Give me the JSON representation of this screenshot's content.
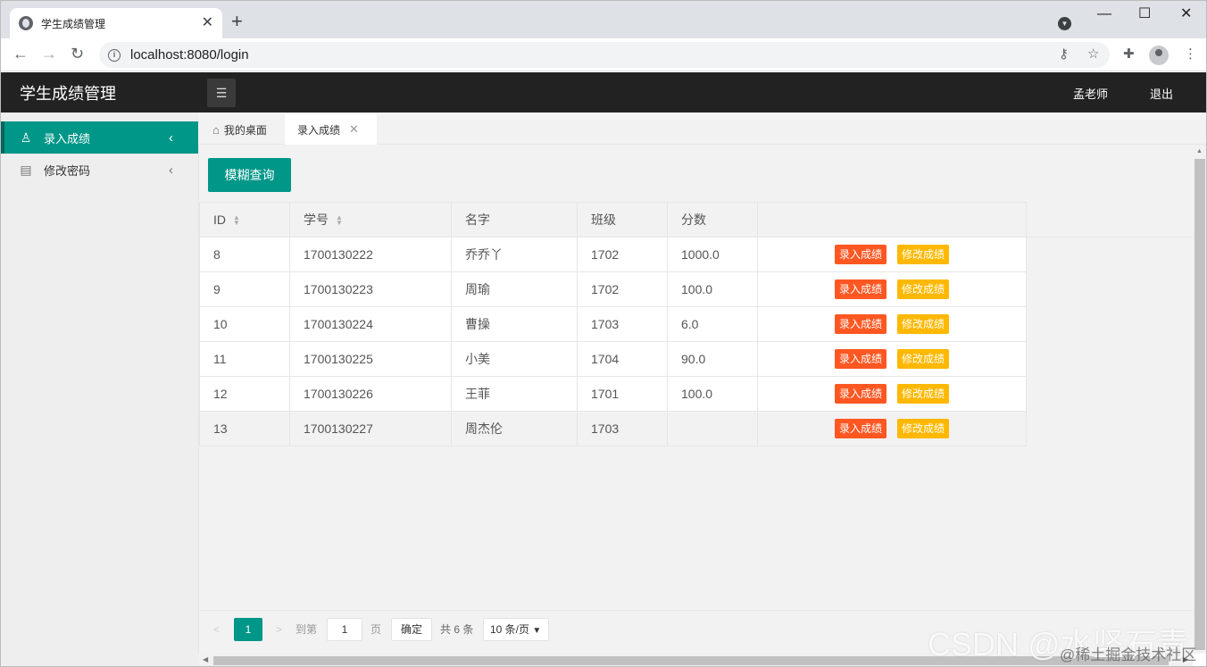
{
  "browser": {
    "tab_title": "学生成绩管理",
    "tab_close": "✕",
    "new_tab": "+",
    "url": "localhost:8080/login",
    "window_minimize": "—",
    "window_maximize": "☐",
    "window_close": "✕"
  },
  "app": {
    "title": "学生成绩管理",
    "user": "孟老师",
    "logout": "退出"
  },
  "sidebar": {
    "items": [
      {
        "label": "录入成绩",
        "icon": "user-icon",
        "active": true
      },
      {
        "label": "修改密码",
        "icon": "document-icon",
        "active": false
      }
    ]
  },
  "content_tabs": {
    "home": "我的桌面",
    "current": "录入成绩",
    "close": "✕"
  },
  "toolbar": {
    "search_label": "模糊查询"
  },
  "table": {
    "headers": [
      "ID",
      "学号",
      "名字",
      "班级",
      "分数",
      ""
    ],
    "rows": [
      {
        "id": "8",
        "student_no": "1700130222",
        "name": "乔乔丫",
        "class": "1702",
        "score": "1000.0"
      },
      {
        "id": "9",
        "student_no": "1700130223",
        "name": "周瑜",
        "class": "1702",
        "score": "100.0"
      },
      {
        "id": "10",
        "student_no": "1700130224",
        "name": "曹操",
        "class": "1703",
        "score": "6.0"
      },
      {
        "id": "11",
        "student_no": "1700130225",
        "name": "小美",
        "class": "1704",
        "score": "90.0"
      },
      {
        "id": "12",
        "student_no": "1700130226",
        "name": "王菲",
        "class": "1701",
        "score": "100.0"
      },
      {
        "id": "13",
        "student_no": "1700130227",
        "name": "周杰伦",
        "class": "1703",
        "score": ""
      }
    ],
    "action_enter": "录入成绩",
    "action_modify": "修改成绩"
  },
  "pager": {
    "prev": "<",
    "current_page": "1",
    "next": ">",
    "goto_label": "到第",
    "goto_value": "1",
    "page_unit": "页",
    "confirm": "确定",
    "total": "共 6 条",
    "page_size": "10 条/页"
  },
  "watermark": {
    "main": "CSDN @水坚石青",
    "sub": "@稀土掘金技术社区"
  },
  "colors": {
    "primary": "#009688",
    "header_bg": "#222222",
    "danger": "#ff5722",
    "warning": "#ffb800"
  }
}
